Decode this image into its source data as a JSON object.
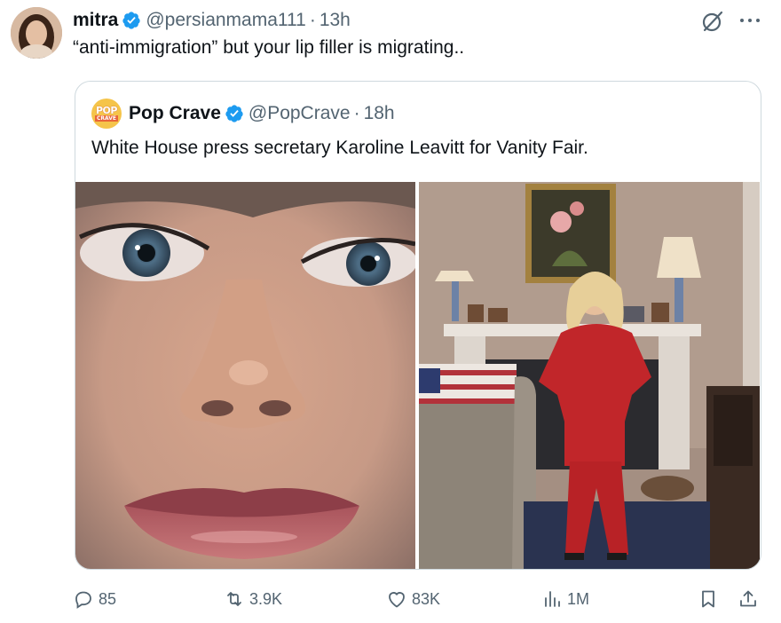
{
  "tweet": {
    "author": {
      "name": "mitra",
      "handle": "@persianmama111",
      "separator": "·",
      "time": "13h"
    },
    "text": "“anti-immigration” but your lip filler is migrating..",
    "icons": {
      "grok": "grok-icon",
      "more": "more-dots-icon",
      "verified": "verified-badge-icon"
    }
  },
  "quoted": {
    "author": {
      "name": "Pop Crave",
      "handle": "@PopCrave",
      "separator": "·",
      "time": "18h",
      "avatar_text_top": "POP",
      "avatar_text_bottom": "CRAVE"
    },
    "text": "White House press secretary Karoline Leavitt for Vanity Fair.",
    "media": [
      {
        "kind": "photo",
        "description_icon": "closeup-face-photo"
      },
      {
        "kind": "photo",
        "description_icon": "standing-portrait-photo"
      }
    ]
  },
  "actions": {
    "replies": "85",
    "reposts": "3.9K",
    "likes": "83K",
    "views": "1M",
    "icons": [
      "reply-icon",
      "repost-icon",
      "like-icon",
      "views-icon",
      "bookmark-icon",
      "share-icon"
    ]
  },
  "colors": {
    "text": "#0f1419",
    "secondary": "#536471",
    "verified": "#1d9bf0",
    "border": "#cfd9de"
  }
}
